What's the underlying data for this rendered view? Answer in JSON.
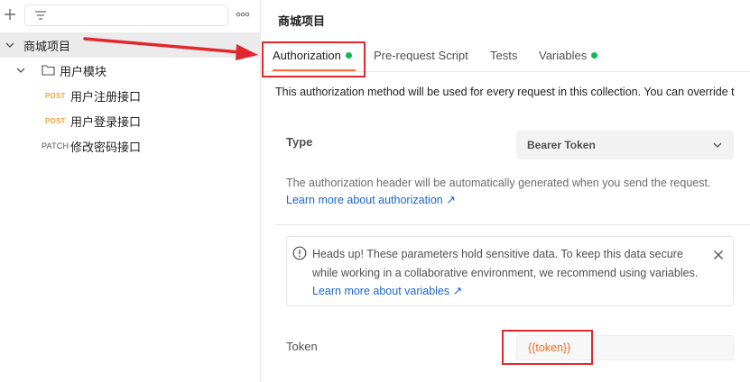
{
  "sidebar": {
    "icons": {
      "add": "plus-icon",
      "filter": "filter-icon",
      "more": "more-horizontal-icon"
    },
    "collection": {
      "name": "商城项目"
    },
    "folder": {
      "name": "用户模块"
    },
    "requests": [
      {
        "method": "POST",
        "name": "用户注册接口"
      },
      {
        "method": "POST",
        "name": "用户登录接口"
      },
      {
        "method": "PATCH",
        "name": "修改密码接口"
      }
    ]
  },
  "main": {
    "title": "商城项目",
    "tabs": [
      {
        "label": "Authorization",
        "active": true,
        "dot": true
      },
      {
        "label": "Pre-request Script",
        "active": false,
        "dot": false
      },
      {
        "label": "Tests",
        "active": false,
        "dot": false
      },
      {
        "label": "Variables",
        "active": false,
        "dot": true
      }
    ],
    "description": "This authorization method will be used for every request in this collection. You can override t",
    "type_label": "Type",
    "type_value": "Bearer Token",
    "help_text": "The authorization header will be automatically generated when you send the request.",
    "help_link": "Learn more about authorization ↗",
    "alert": {
      "text": "Heads up! These parameters hold sensitive data. To keep this data secure while working in a collaborative environment, we recommend using variables. ",
      "link": "Learn more about variables ↗"
    },
    "token_label": "Token",
    "token_value": "{{token}}"
  },
  "colors": {
    "accent": "#ff6c37",
    "status_dot": "#0cbb52",
    "link": "#1d66c7",
    "post": "#f2a33a",
    "annotation": "#e0282e"
  }
}
